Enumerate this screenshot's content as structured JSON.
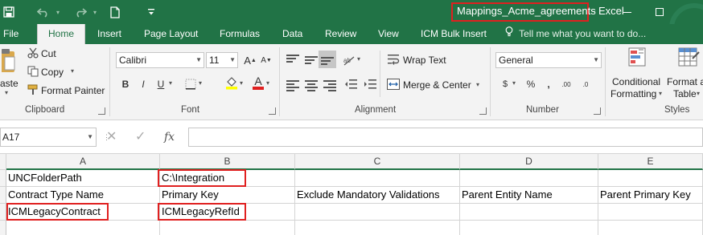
{
  "window": {
    "file_name": "Mappings_Acme_agreements",
    "separator": "-",
    "app_name": "Excel",
    "save_icon": "save-icon",
    "undo_icon": "undo-icon",
    "redo_icon": "redo-icon",
    "new_icon": "new-file-icon",
    "customize_icon": "customize-toolbar-icon",
    "minimize_icon": "minimize-icon",
    "restore_icon": "restore-icon"
  },
  "tabs": [
    {
      "label": "File"
    },
    {
      "label": "Home",
      "active": true
    },
    {
      "label": "Insert"
    },
    {
      "label": "Page Layout"
    },
    {
      "label": "Formulas"
    },
    {
      "label": "Data"
    },
    {
      "label": "Review"
    },
    {
      "label": "View"
    },
    {
      "label": "ICM Bulk Insert"
    }
  ],
  "tell_me": "Tell me what you want to do...",
  "ribbon": {
    "clipboard": {
      "label": "Clipboard",
      "paste": "aste",
      "cut": "Cut",
      "copy": "Copy",
      "format_painter": "Format Painter"
    },
    "font": {
      "label": "Font",
      "font_name": "Calibri",
      "font_size": "11",
      "grow": "A",
      "shrink": "A",
      "bold": "B",
      "italic": "I",
      "underline": "U",
      "font_color_letter": "A",
      "highlight_color": "#ffff00",
      "font_color": "#e02020"
    },
    "alignment": {
      "label": "Alignment",
      "wrap_text": "Wrap Text",
      "merge_center": "Merge & Center"
    },
    "number": {
      "label": "Number",
      "format": "General",
      "currency": "$",
      "percent": "%",
      "comma": ",",
      "inc_decimal": ".00",
      "dec_decimal": ".0"
    },
    "styles": {
      "label": "Styles",
      "conditional_formatting": [
        "Conditional",
        "Formatting"
      ],
      "format_as_table": [
        "Format as",
        "Table"
      ]
    }
  },
  "formula_bar": {
    "name_box": "A17",
    "cancel": "✕",
    "enter": "✓",
    "fx": "fx",
    "value": ""
  },
  "columns": [
    "A",
    "B",
    "C",
    "D",
    "E"
  ],
  "rows": [
    [
      "UNCFolderPath",
      "C:\\Integration",
      "",
      "",
      ""
    ],
    [
      "Contract Type Name",
      "Primary Key",
      "Exclude Mandatory Validations",
      "Parent Entity Name",
      "Parent Primary Key"
    ],
    [
      "ICMLegacyContract",
      "ICMLegacyRefId",
      "",
      "",
      ""
    ],
    [
      "",
      "",
      "",
      "",
      ""
    ]
  ],
  "colors": {
    "excel_green": "#217346",
    "highlight_red": "#e02020"
  }
}
